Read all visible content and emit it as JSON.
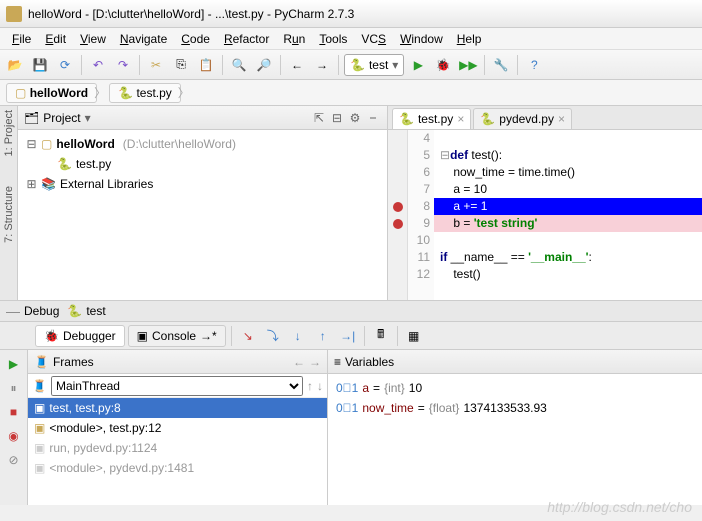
{
  "window": {
    "title": "helloWord - [D:\\clutter\\helloWord] - ...\\test.py - PyCharm 2.7.3"
  },
  "menu": [
    "File",
    "Edit",
    "View",
    "Navigate",
    "Code",
    "Refactor",
    "Run",
    "Tools",
    "VCS",
    "Window",
    "Help"
  ],
  "run_config": {
    "label": "test"
  },
  "breadcrumb": {
    "project": "helloWord",
    "file": "test.py"
  },
  "sidebar_tabs": {
    "project": "1: Project",
    "structure": "7: Structure"
  },
  "project_panel": {
    "title": "Project",
    "root": "helloWord",
    "root_path": "(D:\\clutter\\helloWord)",
    "file": "test.py",
    "ext_libs": "External Libraries"
  },
  "editor": {
    "tabs": [
      {
        "name": "test.py",
        "active": true
      },
      {
        "name": "pydevd.py",
        "active": false
      }
    ],
    "line_start": 4,
    "lines": [
      "",
      "def test():",
      "    now_time = time.time()",
      "    a = 10",
      "    a += 1",
      "    b = 'test string'",
      "",
      "if __name__ == '__main__':",
      "    test()"
    ],
    "breakpoints": [
      8,
      9
    ],
    "current_line": 8,
    "pink_line": 9
  },
  "debug": {
    "title": "Debug",
    "config": "test",
    "tab_debugger": "Debugger",
    "tab_console": "Console",
    "frames_title": "Frames",
    "thread": "MainThread",
    "frames": [
      {
        "label": "test, test.py:8",
        "current": true
      },
      {
        "label": "<module>, test.py:12",
        "current": false
      },
      {
        "label": "run, pydevd.py:1124",
        "current": false,
        "dim": true
      },
      {
        "label": "<module>, pydevd.py:1481",
        "current": false,
        "dim": true
      }
    ],
    "vars_title": "Variables",
    "vars": [
      {
        "name": "a",
        "type": "{int}",
        "value": "10"
      },
      {
        "name": "now_time",
        "type": "{float}",
        "value": "1374133533.93"
      }
    ]
  },
  "watermark": "http://blog.csdn.net/cho"
}
